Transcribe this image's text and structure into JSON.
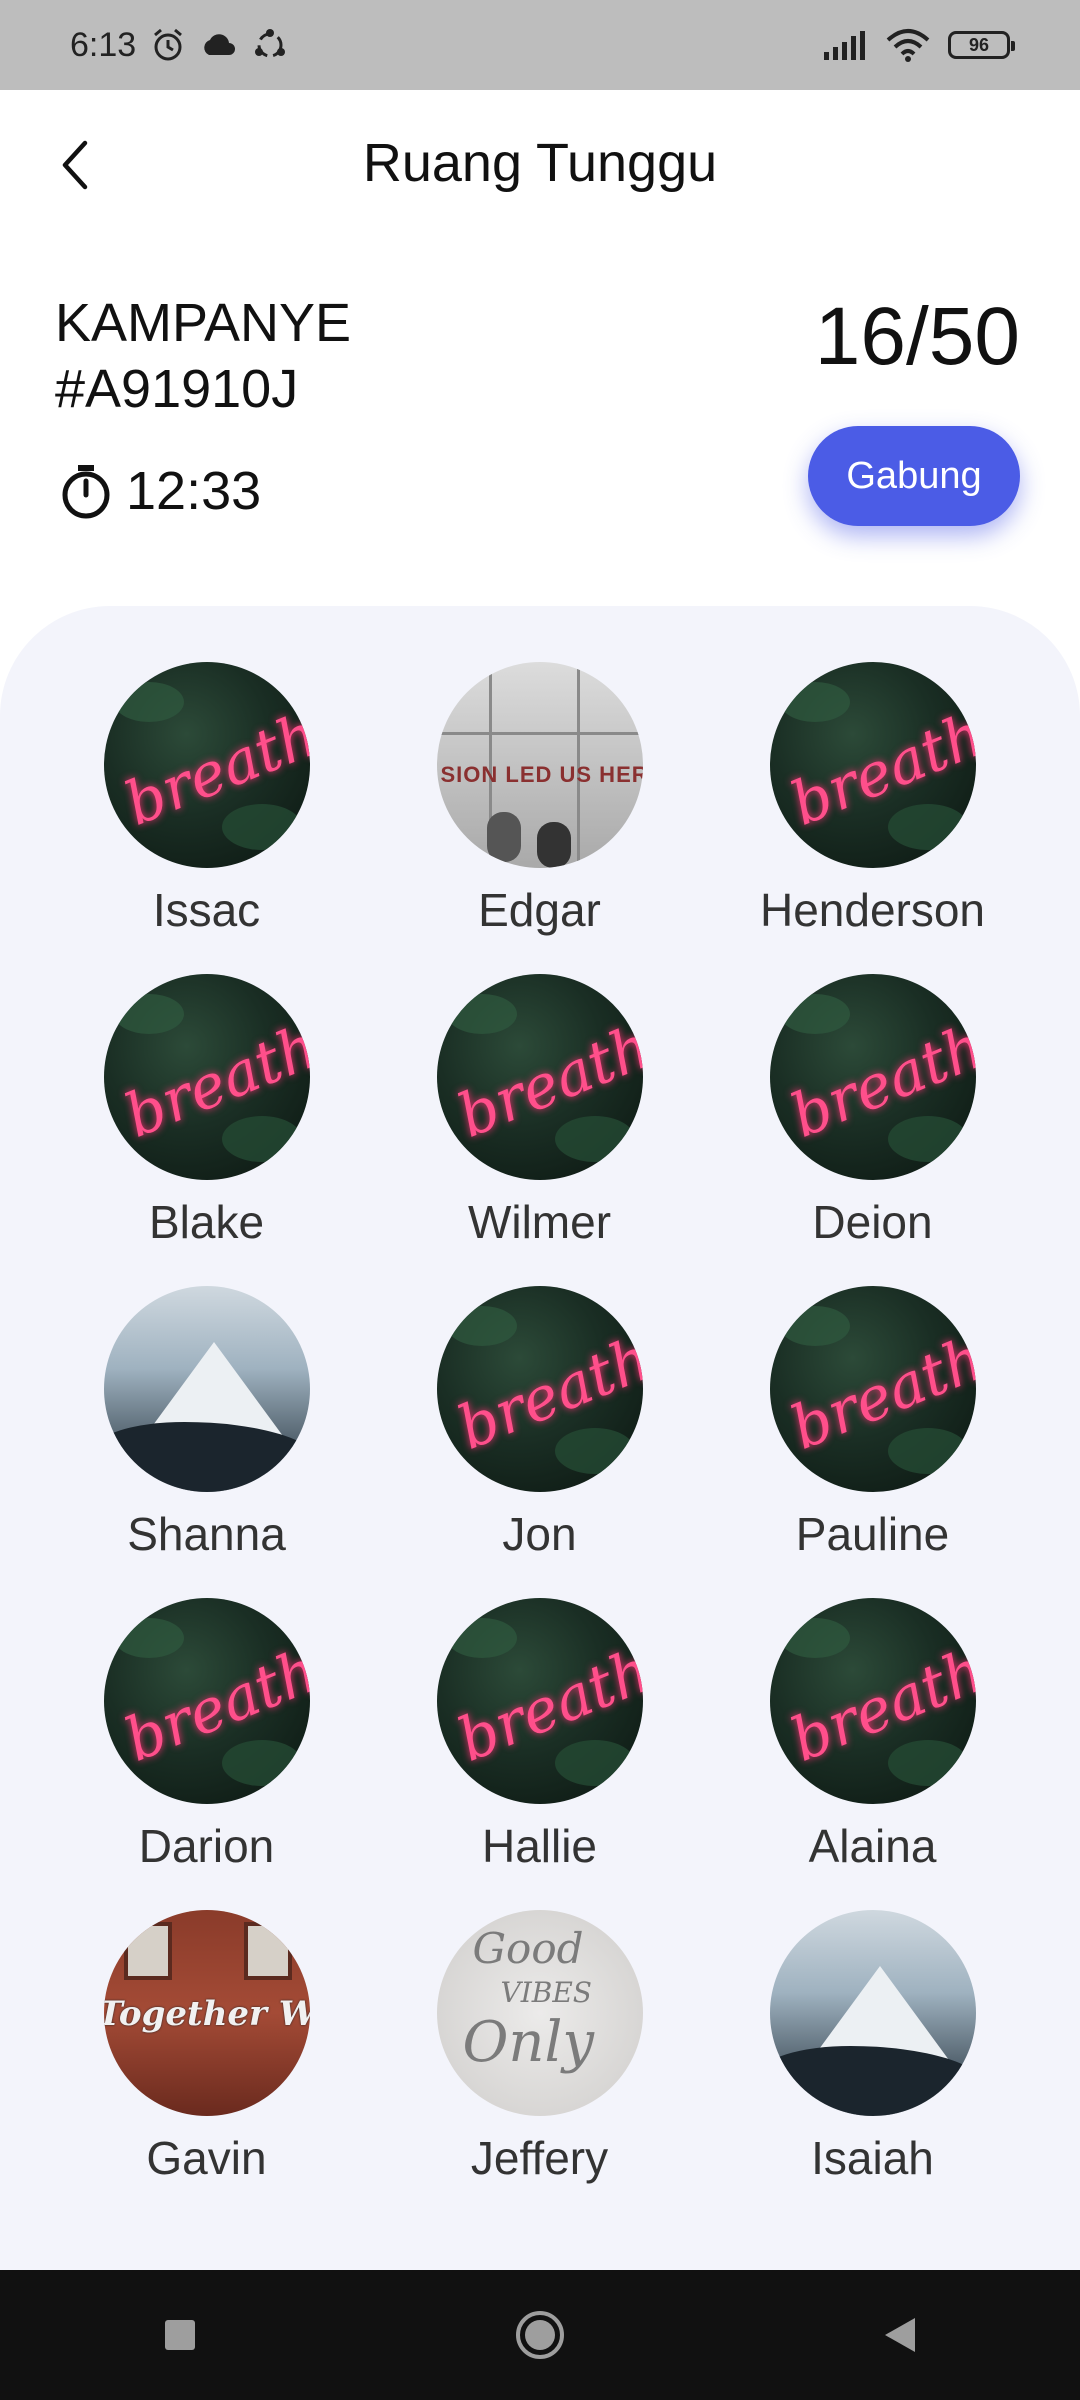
{
  "status_bar": {
    "time": "6:13",
    "battery": "96",
    "icons": [
      "alarm-icon",
      "cloud-icon",
      "sync-icon",
      "signal-icon",
      "wifi-icon",
      "battery-icon"
    ]
  },
  "header": {
    "title": "Ruang Tunggu",
    "back_icon": "chevron-left-icon"
  },
  "campaign": {
    "name_line1": "KAMPANYE",
    "name_line2": "#A91910J",
    "timer": "12:33",
    "timer_icon": "stopwatch-icon",
    "count": "16/50",
    "join_label": "Gabung",
    "accent_color": "#4b5ce6"
  },
  "members": [
    {
      "name": "Issac",
      "avatar": "breathe"
    },
    {
      "name": "Edgar",
      "avatar": "vision"
    },
    {
      "name": "Henderson",
      "avatar": "breathe"
    },
    {
      "name": "Blake",
      "avatar": "breathe"
    },
    {
      "name": "Wilmer",
      "avatar": "breathe"
    },
    {
      "name": "Deion",
      "avatar": "breathe"
    },
    {
      "name": "Shanna",
      "avatar": "mountain"
    },
    {
      "name": "Jon",
      "avatar": "breathe"
    },
    {
      "name": "Pauline",
      "avatar": "breathe"
    },
    {
      "name": "Darion",
      "avatar": "breathe"
    },
    {
      "name": "Hallie",
      "avatar": "breathe"
    },
    {
      "name": "Alaina",
      "avatar": "breathe"
    },
    {
      "name": "Gavin",
      "avatar": "together"
    },
    {
      "name": "Jeffery",
      "avatar": "good"
    },
    {
      "name": "Isaiah",
      "avatar": "mountain"
    }
  ],
  "avatar_texts": {
    "breathe": "breathe",
    "vision": "SION LED US HERE",
    "together": "Together We C",
    "good_line1": "Good",
    "good_line2": "VIBES",
    "good_line3": "Only"
  },
  "nav": [
    "recents-button",
    "home-button",
    "back-button"
  ]
}
